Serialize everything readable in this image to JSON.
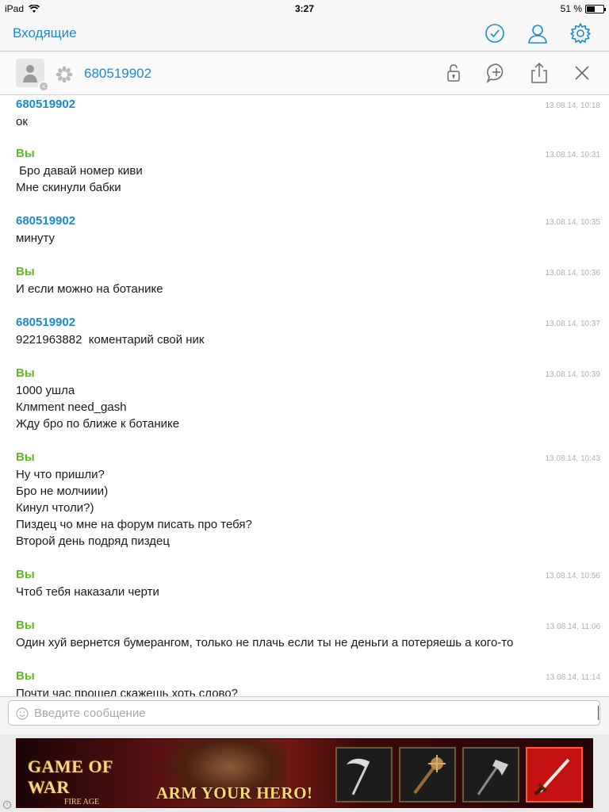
{
  "status_bar": {
    "device": "iPad",
    "time": "3:27",
    "battery": "51 %",
    "battery_level": 0.51
  },
  "nav": {
    "back_label": "Входящие",
    "icons": [
      "checkmark-circle-icon",
      "person-icon",
      "gear-icon"
    ]
  },
  "chat_header": {
    "contact_name": "680519902",
    "icons": [
      "lock-icon",
      "add-comment-icon",
      "share-icon",
      "close-icon"
    ]
  },
  "messages": [
    {
      "sender": "680519902",
      "from_me": false,
      "time": "13.08.14, 10:18",
      "lines": [
        "ок"
      ]
    },
    {
      "sender": "Вы",
      "from_me": true,
      "time": "13.08.14, 10:31",
      "lines": [
        " Бро давай номер киви",
        "Мне скинули бабки"
      ]
    },
    {
      "sender": "680519902",
      "from_me": false,
      "time": "13.08.14, 10:35",
      "lines": [
        "минуту"
      ]
    },
    {
      "sender": "Вы",
      "from_me": true,
      "time": "13.08.14, 10:36",
      "lines": [
        "И если можно на ботанике"
      ]
    },
    {
      "sender": "680519902",
      "from_me": false,
      "time": "13.08.14, 10:37",
      "lines": [
        "9221963882  коментарий свой ник"
      ]
    },
    {
      "sender": "Вы",
      "from_me": true,
      "time": "13.08.14, 10:39",
      "lines": [
        "1000 ушла",
        "Клмment need_gash",
        "Жду бро по ближе к ботанике"
      ]
    },
    {
      "sender": "Вы",
      "from_me": true,
      "time": "13.08.14, 10:43",
      "lines": [
        "Ну что пришли?",
        "Бро не молчиии)",
        "Кинул чтоли?)",
        "Пиздец чо мне на форум писать про тебя?",
        "Второй день подряд пиздец"
      ]
    },
    {
      "sender": "Вы",
      "from_me": true,
      "time": "13.08.14, 10:56",
      "lines": [
        "Чтоб тебя наказали черти"
      ]
    },
    {
      "sender": "Вы",
      "from_me": true,
      "time": "13.08.14, 11:06",
      "lines": [
        "Один хуй вернется бумерангом, только не плачь если ты не деньги а потеряешь а кого-то"
      ]
    },
    {
      "sender": "Вы",
      "from_me": true,
      "time": "13.08.14, 11:14",
      "lines": [
        "Почти час прошел скажешь хоть слово?"
      ]
    }
  ],
  "composer": {
    "placeholder": "Введите сообщение",
    "value": ""
  },
  "ad": {
    "logo_title": "GAME OF WAR",
    "logo_subtitle": "FIRE AGE",
    "tagline": "ARM YOUR HERO!",
    "item_slots": [
      "scythe-icon",
      "mace-icon",
      "axe-icon",
      "sword-icon"
    ]
  }
}
